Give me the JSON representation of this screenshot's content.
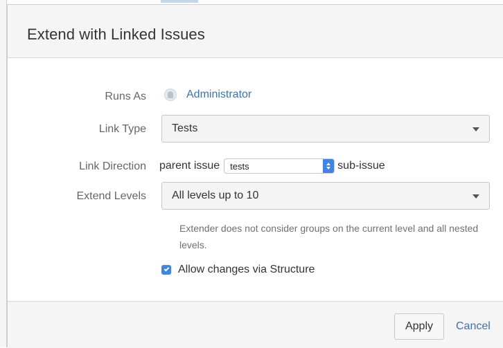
{
  "dialog": {
    "title": "Extend with Linked Issues"
  },
  "form": {
    "runs_as": {
      "label": "Runs As",
      "value": "Administrator"
    },
    "link_type": {
      "label": "Link Type",
      "selected": "Tests"
    },
    "link_direction": {
      "label": "Link Direction",
      "prefix": "parent issue",
      "selected": "tests",
      "suffix": "sub-issue"
    },
    "extend_levels": {
      "label": "Extend Levels",
      "selected": "All levels up to 10",
      "help": "Extender does not consider groups on the current level and all nested levels."
    },
    "allow_changes": {
      "label": "Allow changes via Structure",
      "checked": true
    }
  },
  "footer": {
    "apply_label": "Apply",
    "cancel_label": "Cancel"
  },
  "colors": {
    "accent": "#3d86e8",
    "link": "#3b73af",
    "header_bg": "#f5f5f5"
  },
  "icons": {
    "avatar": "user-avatar-icon",
    "dropdown": "chevron-down-icon",
    "stepper": "up-down-stepper-icon",
    "checkbox": "checkmark-icon"
  }
}
